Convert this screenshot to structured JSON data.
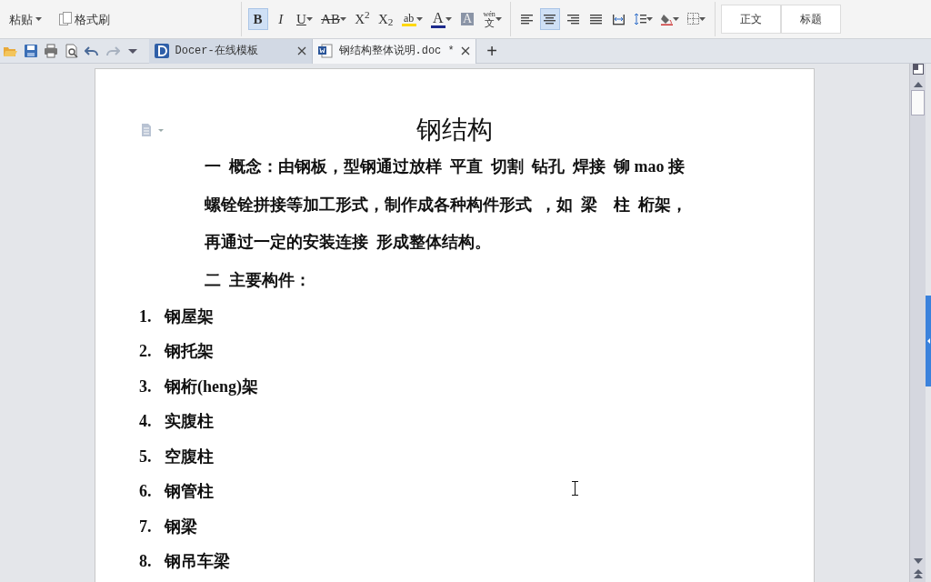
{
  "ribbon": {
    "clipboard": [
      {
        "kind": "paste",
        "label": "粘贴",
        "dropdown": true
      },
      {
        "kind": "format_painter",
        "label": "格式刷",
        "dropdown": false
      }
    ],
    "font_buttons": [
      {
        "kind": "bold",
        "label": "B",
        "selected": true,
        "dropdown": false
      },
      {
        "kind": "italic",
        "label": "I",
        "selected": false,
        "dropdown": false
      },
      {
        "kind": "underline",
        "label": "U",
        "selected": false,
        "dropdown": true
      },
      {
        "kind": "strike",
        "label": "AB",
        "selected": false,
        "dropdown": true
      },
      {
        "kind": "superscript",
        "label": "X$^{2}$",
        "selected": false,
        "dropdown": false
      },
      {
        "kind": "subscript",
        "label": "X$_{2}$",
        "selected": false,
        "dropdown": false
      },
      {
        "kind": "highlight",
        "label": "ab",
        "selected": false,
        "dropdown": true,
        "color": "#ffd800"
      },
      {
        "kind": "fontcolor",
        "label": "A",
        "selected": false,
        "dropdown": true,
        "color": "#1c2a8c"
      },
      {
        "kind": "shading",
        "label": "A",
        "selected": false,
        "dropdown": false
      },
      {
        "kind": "phonetic",
        "label": "wén",
        "sub": "文",
        "selected": false,
        "dropdown": true
      }
    ],
    "paragraph_buttons": [
      {
        "kind": "align_left",
        "selected": false,
        "dropdown": false
      },
      {
        "kind": "align_center",
        "selected": true,
        "dropdown": false
      },
      {
        "kind": "align_right",
        "selected": false,
        "dropdown": false
      },
      {
        "kind": "justify",
        "selected": false,
        "dropdown": false
      },
      {
        "kind": "distribute",
        "selected": false,
        "dropdown": false
      },
      {
        "kind": "line_spacing",
        "selected": false,
        "dropdown": true
      },
      {
        "kind": "fill",
        "selected": false,
        "dropdown": true
      },
      {
        "kind": "borders",
        "selected": false,
        "dropdown": true
      }
    ],
    "styles": [
      "正文",
      "标题"
    ]
  },
  "quick_access": [
    {
      "kind": "open"
    },
    {
      "kind": "save"
    },
    {
      "kind": "print"
    },
    {
      "kind": "preview"
    },
    {
      "kind": "undo"
    },
    {
      "kind": "redo"
    },
    {
      "kind": "more"
    }
  ],
  "tabs": [
    {
      "kind": "docer",
      "label": "Docer-在线模板",
      "selected": false
    },
    {
      "kind": "document",
      "label": "钢结构整体说明.doc *",
      "selected": true
    }
  ],
  "new_tab": "+",
  "document": {
    "title": "钢结构",
    "lines": [
      "一  概念：由钢板，型钢通过放样  平直  切割  钻孔  焊接  铆 mao 接",
      "螺铨铨拼接等加工形式，制作成各种构件形式  ，如  梁    柱  桁架，",
      "再通过一定的安装连接  形成整体结构。",
      "二  主要构件："
    ],
    "list": [
      {
        "number": "1.",
        "text": "钢屋架"
      },
      {
        "number": "2.",
        "text": "钢托架"
      },
      {
        "number": "3.",
        "text": "钢桁(heng)架"
      },
      {
        "number": "4.",
        "text": "实腹柱"
      },
      {
        "number": "5.",
        "text": "空腹柱"
      },
      {
        "number": "6.",
        "text": "钢管柱"
      },
      {
        "number": "7.",
        "text": "钢梁"
      },
      {
        "number": "8.",
        "text": "钢吊车梁"
      }
    ]
  }
}
